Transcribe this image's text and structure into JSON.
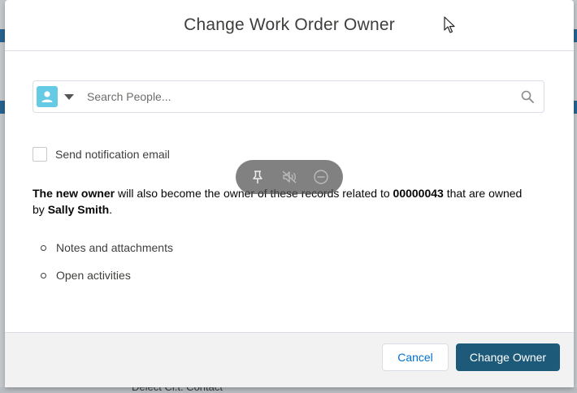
{
  "modal": {
    "title": "Change Work Order Owner"
  },
  "search": {
    "placeholder": "Search People...",
    "value": ""
  },
  "notification": {
    "label": "Send notification email",
    "checked": false
  },
  "info": {
    "part1": "The new owner",
    "part2": " will also become the owner of these records related to ",
    "record_number": "00000043",
    "part3": " that are owned by ",
    "owner_name": "Sally Smith",
    "part4": "."
  },
  "related_records": [
    "Notes and attachments",
    "Open activities"
  ],
  "footer": {
    "cancel_label": "Cancel",
    "primary_label": "Change Owner"
  },
  "background": {
    "peek_text": "Delect Cl.t. Contact"
  },
  "colors": {
    "accent": "#1d5a79",
    "link": "#0070d2",
    "avatar": "#65cae4"
  },
  "icons": {
    "avatar": "person-icon",
    "dropdown": "caret-down-icon",
    "search": "search-icon",
    "overlay": [
      "pin-icon",
      "mute-icon",
      "minus-circle-icon"
    ]
  }
}
